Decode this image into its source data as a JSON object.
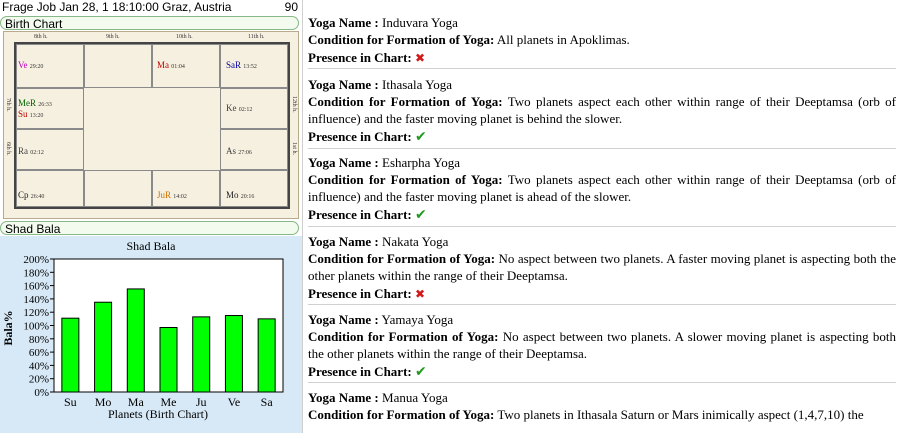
{
  "header": {
    "title": "Frage Job Jan 28, 1 18:10:00  Graz, Austria",
    "number": "90"
  },
  "birth_chart": {
    "tab_label": "Birth Chart",
    "house_labels": {
      "h8": "8th h.",
      "h9": "9th h.",
      "h10": "10th h.",
      "h11": "11th h.",
      "h7": "7th h.",
      "h12": "12th h.",
      "h6": "6th h.",
      "h1": "1st h."
    },
    "planets": {
      "ve": {
        "name": "Ve",
        "deg": "29:20",
        "color": "#c000c0"
      },
      "ma": {
        "name": "Ma",
        "deg": "01:04",
        "color": "#c00000"
      },
      "sar": {
        "name": "SaR",
        "deg": "13:52",
        "color": "#0000a0"
      },
      "mer": {
        "name": "MeR",
        "deg": "26:33",
        "color": "#006000"
      },
      "su": {
        "name": "Su",
        "deg": "13:20",
        "color": "#c00000"
      },
      "ke": {
        "name": "Ke",
        "deg": "02:12",
        "color": "#404040"
      },
      "ra": {
        "name": "Ra",
        "deg": "02:12",
        "color": "#404040"
      },
      "as": {
        "name": "As",
        "deg": "27:06",
        "color": "#404040"
      },
      "cp": {
        "name": "Cp",
        "deg": "26:40",
        "color": "#202020"
      },
      "jur": {
        "name": "JuR",
        "deg": "14:02",
        "color": "#d07000"
      },
      "mo": {
        "name": "Mo",
        "deg": "20:16",
        "color": "#202020"
      }
    }
  },
  "shad_bala_tab": {
    "label": "Shad Bala"
  },
  "chart_data": {
    "type": "bar",
    "title": "Shad Bala",
    "xlabel": "Planets (Birth Chart)",
    "ylabel": "Bala%",
    "categories": [
      "Su",
      "Mo",
      "Ma",
      "Me",
      "Ju",
      "Ve",
      "Sa"
    ],
    "values": [
      111,
      135,
      155,
      97,
      113,
      115,
      110
    ],
    "ylim": [
      0,
      200
    ],
    "yticks": [
      "0%",
      "20%",
      "40%",
      "60%",
      "80%",
      "100%",
      "120%",
      "140%",
      "160%",
      "180%",
      "200%"
    ],
    "bar_color": "#00ff00",
    "grid": false,
    "legend": "none"
  },
  "labels": {
    "yoga_name": "Yoga Name :",
    "condition": "Condition for Formation of Yoga:",
    "presence": "Presence in Chart:"
  },
  "yogas": [
    {
      "name": "Induvara Yoga",
      "condition": "All planets in Apoklimas.",
      "present": "✖"
    },
    {
      "name": "Ithasala Yoga",
      "condition": "Two planets aspect each other within range of their Deeptamsa (orb of influence) and the faster moving planet is behind the slower.",
      "present": "✔"
    },
    {
      "name": "Esharpha Yoga",
      "condition": "Two planets aspect each other within range of their Deeptamsa (orb of influence) and the faster moving planet is ahead of the slower.",
      "present": "✔"
    },
    {
      "name": "Nakata Yoga",
      "condition": "No aspect between two planets. A faster moving planet is aspecting both the other planets within the range of their Deeptamsa.",
      "present": "✖"
    },
    {
      "name": "Yamaya Yoga",
      "condition": "No aspect between two planets. A slower moving planet is aspecting both the other planets within the range of their Deeptamsa.",
      "present": "✔"
    },
    {
      "name": "Manua Yoga",
      "condition": "Two planets in Ithasala Saturn or Mars inimically aspect (1,4,7,10) the"
    }
  ]
}
